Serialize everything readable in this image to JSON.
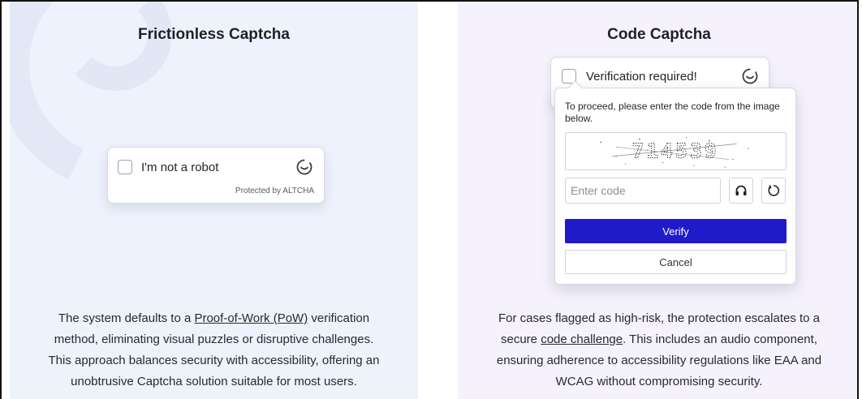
{
  "left": {
    "title": "Frictionless Captcha",
    "widget": {
      "label": "I'm not a robot",
      "protected": "Protected by ALTCHA"
    },
    "description": {
      "line1_pre": "The system defaults to a ",
      "link": "Proof-of-Work (PoW)",
      "line1_post": " verification",
      "line2": "method, eliminating visual puzzles or disruptive challenges.",
      "line3": "This approach balances security with accessibility, offering an",
      "line4": "unobtrusive Captcha solution suitable for most users."
    }
  },
  "right": {
    "title": "Code Captcha",
    "widget": {
      "label": "Verification required!"
    },
    "popover": {
      "instructions": "To proceed, please enter the code from the image below.",
      "code_image_text": "714539",
      "input_placeholder": "Enter code",
      "verify_label": "Verify",
      "cancel_label": "Cancel"
    },
    "description": {
      "line1": "For cases flagged as high-risk, the protection escalates to a",
      "line2_pre": "secure ",
      "link": "code challenge",
      "line2_post": ". This includes an audio component,",
      "line3": "ensuring adherence to accessibility regulations like EAA and",
      "line4": "WCAG without compromising security."
    }
  },
  "colors": {
    "verify_button": "#1f1bc9",
    "left_panel_bg": "#eef2fc",
    "right_panel_bg": "#f6f2fd"
  },
  "icons": [
    "refresh-icon",
    "headphones-icon",
    "reload-icon"
  ]
}
